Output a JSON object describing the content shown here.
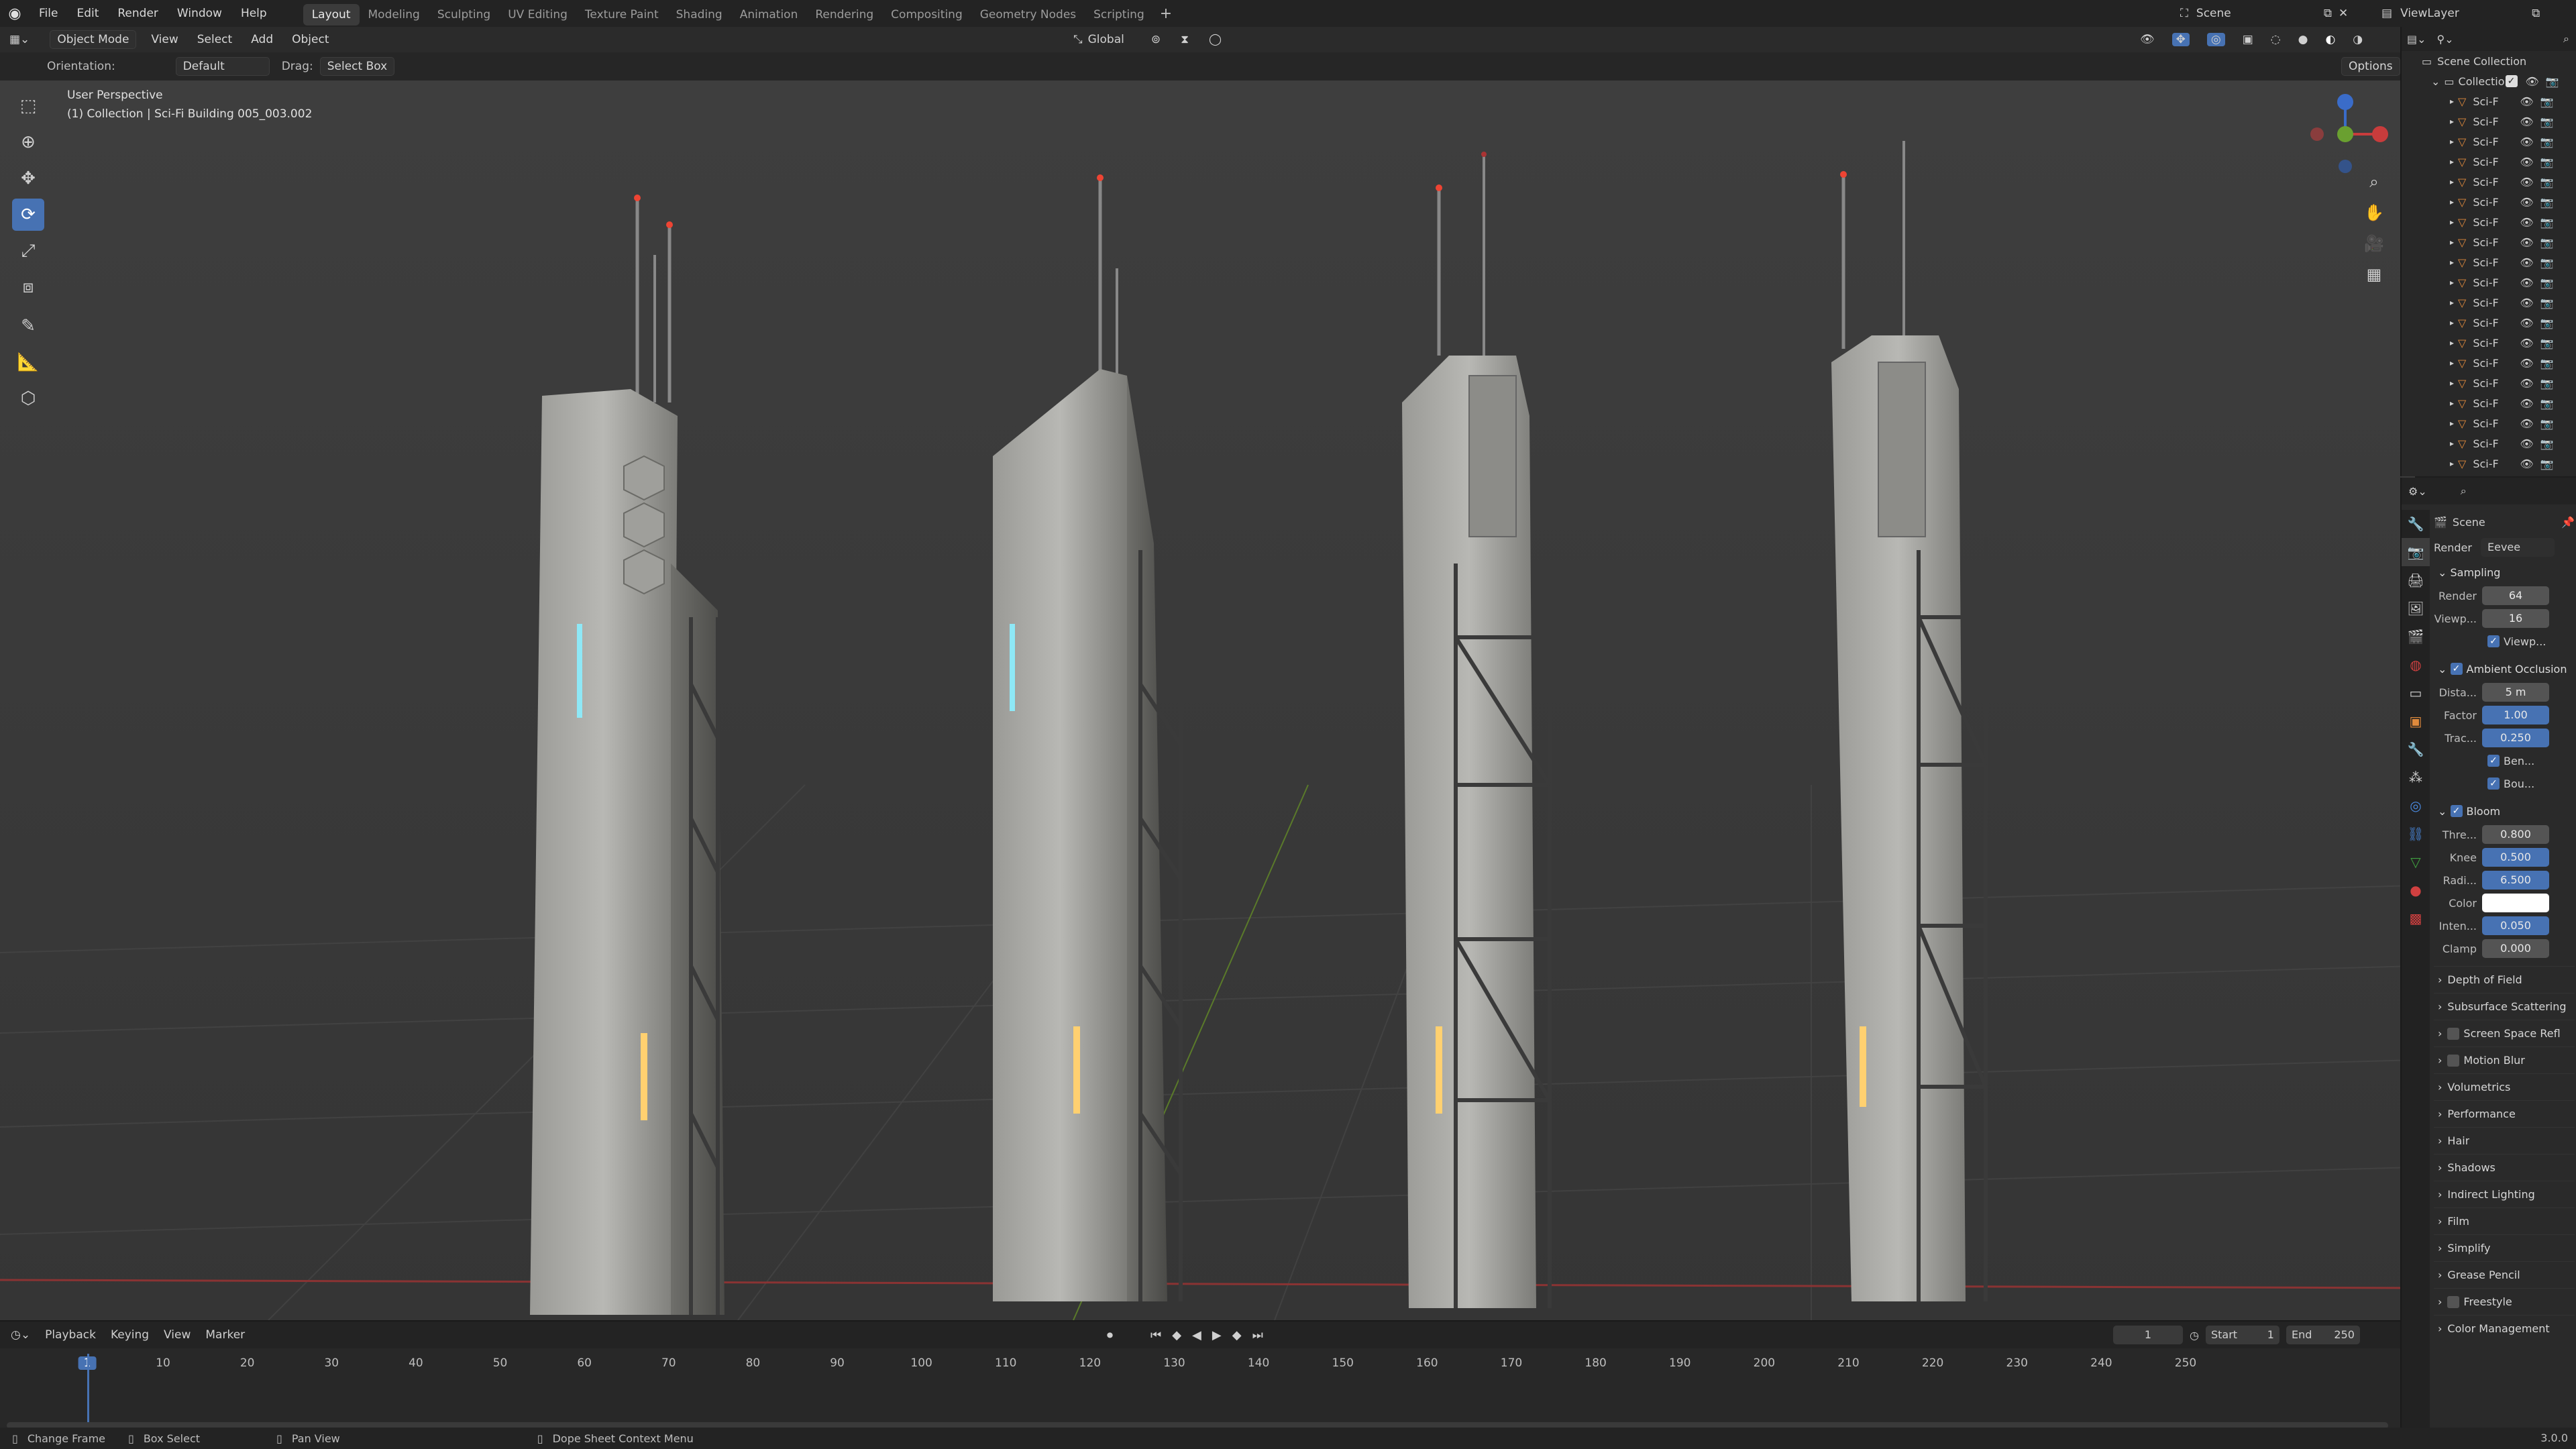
{
  "menu": [
    "File",
    "Edit",
    "Render",
    "Window",
    "Help"
  ],
  "workspaces": [
    "Layout",
    "Modeling",
    "Sculpting",
    "UV Editing",
    "Texture Paint",
    "Shading",
    "Animation",
    "Rendering",
    "Compositing",
    "Geometry Nodes",
    "Scripting"
  ],
  "active_workspace": "Layout",
  "scene_name": "Scene",
  "view_layer": "ViewLayer",
  "header": {
    "mode": "Object Mode",
    "view": "View",
    "select": "Select",
    "add": "Add",
    "object": "Object",
    "transform": "Global"
  },
  "tool_settings": {
    "orientation_label": "Orientation:",
    "orientation_value": "Default",
    "drag_label": "Drag:",
    "drag_value": "Select Box",
    "options": "Options"
  },
  "viewport": {
    "perspective": "User Perspective",
    "collection_info": "(1) Collection | Sci-Fi Building 005_003.002"
  },
  "outliner": {
    "title": "Scene Collection",
    "collection": "Collection",
    "items": [
      "Sci-F",
      "Sci-F",
      "Sci-F",
      "Sci-F",
      "Sci-F",
      "Sci-F",
      "Sci-F",
      "Sci-F",
      "Sci-F",
      "Sci-F",
      "Sci-F",
      "Sci-F",
      "Sci-F",
      "Sci-F",
      "Sci-F",
      "Sci-F",
      "Sci-F",
      "Sci-F",
      "Sci-F"
    ]
  },
  "properties": {
    "scene_label": "Scene",
    "render_engine_label": "Render",
    "render_engine": "Eevee",
    "sampling": {
      "title": "Sampling",
      "render_label": "Render",
      "render_value": "64",
      "viewport_label": "Viewp...",
      "viewport_value": "16",
      "viewport_denoise": "Viewp..."
    },
    "ao": {
      "title": "Ambient Occlusion",
      "distance_label": "Dista...",
      "distance": "5 m",
      "factor_label": "Factor",
      "factor": "1.00",
      "trace_label": "Trac...",
      "trace": "0.250",
      "bent_label": "Ben...",
      "bounce_label": "Bou..."
    },
    "bloom": {
      "title": "Bloom",
      "threshold_label": "Thre...",
      "threshold": "0.800",
      "knee_label": "Knee",
      "knee": "0.500",
      "radius_label": "Radi...",
      "radius": "6.500",
      "color_label": "Color",
      "intensity_label": "Inten...",
      "intensity": "0.050",
      "clamp_label": "Clamp",
      "clamp": "0.000"
    },
    "collapsed": [
      "Depth of Field",
      "Subsurface Scattering",
      "Screen Space Refl",
      "Motion Blur",
      "Volumetrics",
      "Performance",
      "Hair",
      "Shadows",
      "Indirect Lighting",
      "Film",
      "Simplify",
      "Grease Pencil",
      "Freestyle",
      "Color Management"
    ]
  },
  "timeline": {
    "playback": "Playback",
    "keying": "Keying",
    "view": "View",
    "marker": "Marker",
    "current_frame": "1",
    "start_label": "Start",
    "start": "1",
    "end_label": "End",
    "end": "250",
    "ticks": [
      "1",
      "10",
      "20",
      "30",
      "40",
      "50",
      "60",
      "70",
      "80",
      "90",
      "100",
      "110",
      "120",
      "130",
      "140",
      "150",
      "160",
      "170",
      "180",
      "190",
      "200",
      "210",
      "220",
      "230",
      "240",
      "250"
    ]
  },
  "status": {
    "change_frame": "Change Frame",
    "box_select": "Box Select",
    "pan_view": "Pan View",
    "context_menu": "Dope Sheet Context Menu",
    "version": "3.0.0"
  },
  "colors": {
    "accent": "#4772b3",
    "object_orange": "#e08a3c",
    "bg": "#3c3c3c"
  }
}
